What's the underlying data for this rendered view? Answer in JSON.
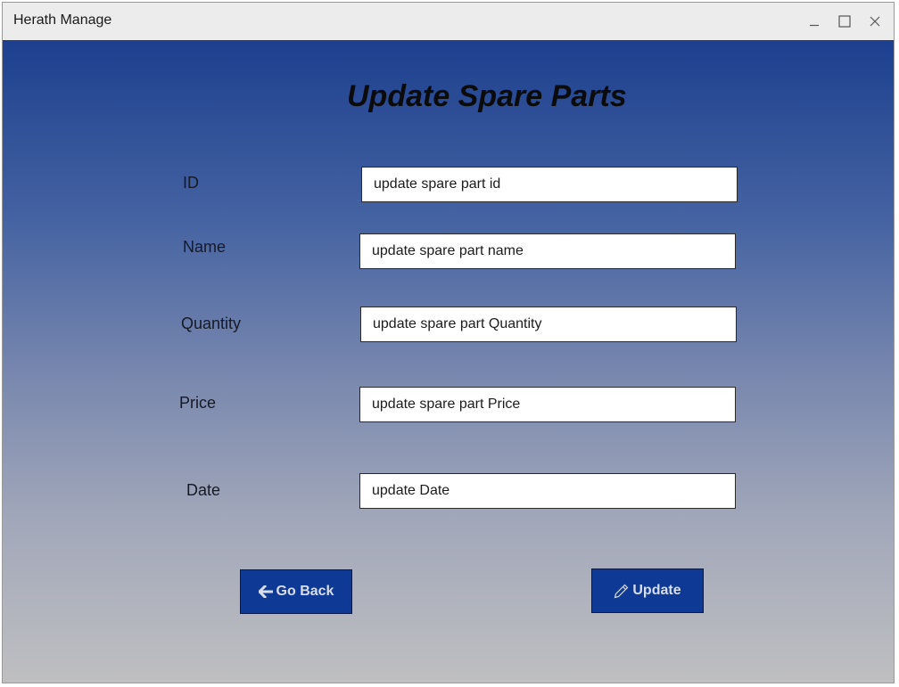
{
  "window": {
    "title": "Herath Manage",
    "controls": [
      "minimize-icon",
      "maximize-icon",
      "close-icon"
    ]
  },
  "page": {
    "heading": "Update Spare Parts"
  },
  "form": {
    "fields": [
      {
        "label": "ID",
        "value": "update spare part id"
      },
      {
        "label": "Name",
        "value": "update spare part name"
      },
      {
        "label": "Quantity",
        "value": "update spare part Quantity"
      },
      {
        "label": "Price",
        "value": "update spare part Price"
      },
      {
        "label": "Date",
        "value": "update Date"
      }
    ]
  },
  "buttons": {
    "go_back": {
      "label": "Go Back",
      "icon": "arrow-left-icon"
    },
    "update": {
      "label": "Update",
      "icon": "pencil-icon"
    }
  },
  "colors": {
    "gradient_top": "#1d3f8e",
    "gradient_bottom": "#bfbfc1",
    "button_bg": "#0e3a96",
    "titlebar_bg": "#ececec"
  }
}
